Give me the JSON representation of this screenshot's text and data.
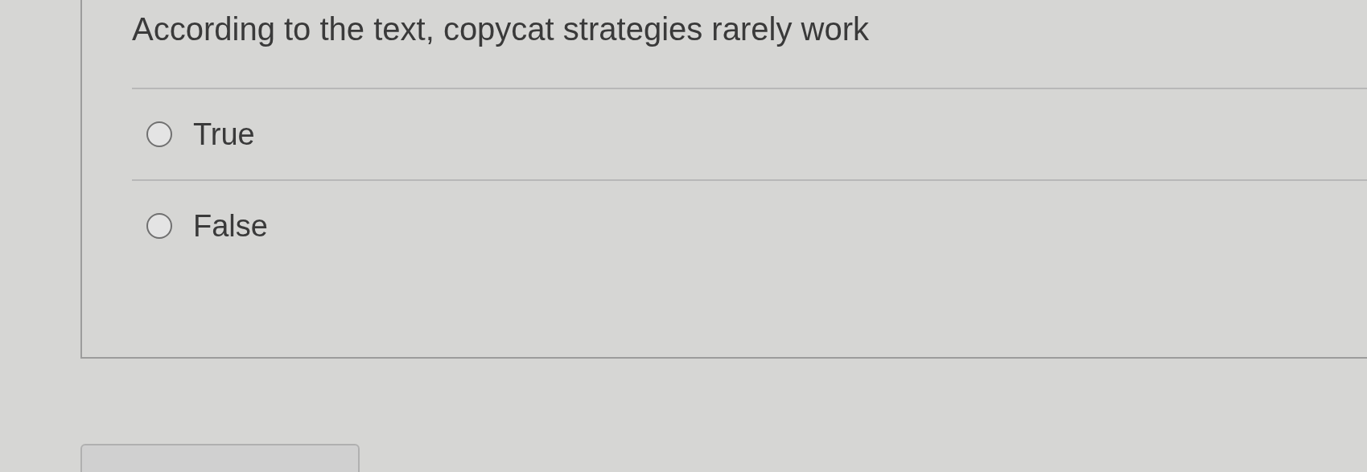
{
  "question": {
    "text": "According to the text, copycat strategies rarely work",
    "options": [
      {
        "label": "True",
        "selected": false
      },
      {
        "label": "False",
        "selected": false
      }
    ]
  }
}
